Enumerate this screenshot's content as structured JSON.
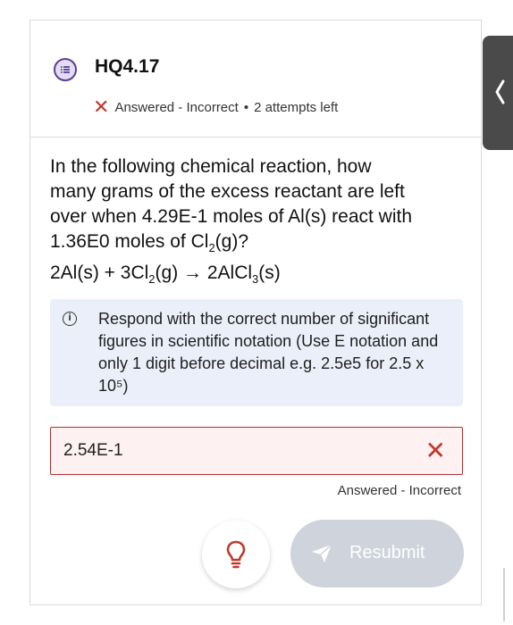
{
  "header": {
    "question_id": "HQ4.17",
    "status": "Answered - Incorrect",
    "separator": "•",
    "attempts": "2 attempts left"
  },
  "question": {
    "line1": "In the following chemical reaction, how",
    "line2": "many grams of the excess reactant are left",
    "line3": "over when 4.29E-1 moles of Al(s) react with",
    "line4_a": "1.36E0 moles of Cl",
    "line4_sub": "2",
    "line4_b": "(g)?",
    "eq_a": "2Al(s) + 3Cl",
    "eq_sub1": "2",
    "eq_b": "(g) → 2AlCl",
    "eq_sub2": "3",
    "eq_c": "(s)"
  },
  "hint": {
    "info_glyph": "i",
    "text": "Respond with the correct number of significant figures in scientific notation (Use E notation and only 1 digit before decimal e.g. 2.5e5 for 2.5 x 10⁵)"
  },
  "answer": {
    "value": "2.54E-1",
    "clear_glyph": "✕",
    "status": "Answered - Incorrect"
  },
  "actions": {
    "resubmit_label": "Resubmit"
  },
  "icons": {
    "question": "list-bubble-icon",
    "incorrect": "x-icon",
    "hint": "lightbulb-icon",
    "send": "send-icon",
    "collapse": "chevron-left-icon"
  },
  "colors": {
    "accent_purple": "#5b3f96",
    "error_red": "#c0392b",
    "hint_bg": "#ebeff9",
    "disabled_button": "#cfd3db"
  }
}
